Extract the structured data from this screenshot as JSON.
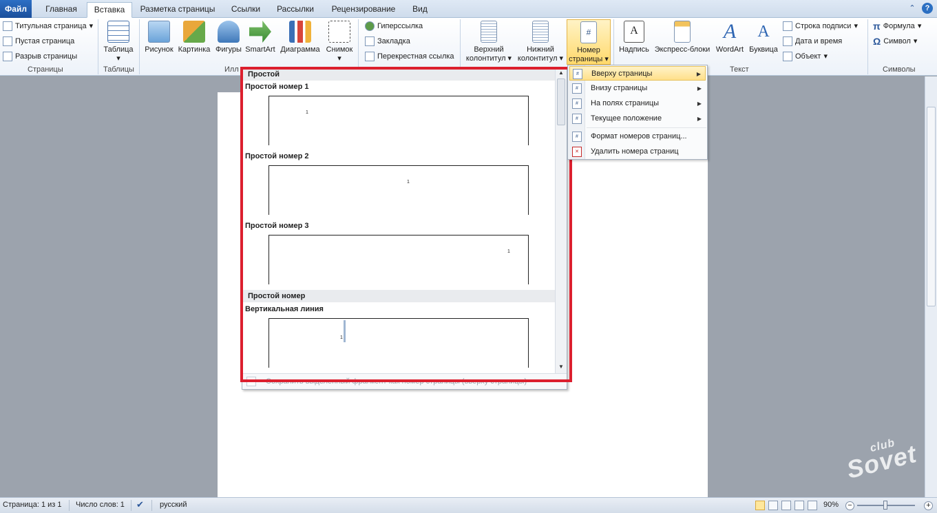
{
  "tabs": [
    {
      "label": "Файл",
      "state": "file"
    },
    {
      "label": "Главная"
    },
    {
      "label": "Вставка",
      "state": "active"
    },
    {
      "label": "Разметка страницы"
    },
    {
      "label": "Ссылки"
    },
    {
      "label": "Рассылки"
    },
    {
      "label": "Рецензирование"
    },
    {
      "label": "Вид"
    }
  ],
  "ribbon": {
    "pages": {
      "title_page": "Титульная страница",
      "blank_page": "Пустая страница",
      "page_break": "Разрыв страницы",
      "group": "Страницы"
    },
    "tables": {
      "table": "Таблица",
      "group": "Таблицы"
    },
    "illustrations": {
      "picture": "Рисунок",
      "clipart": "Картинка",
      "shapes": "Фигуры",
      "smartart": "SmartArt",
      "chart": "Диаграмма",
      "screenshot": "Снимок",
      "group": "Илл"
    },
    "links": {
      "hyperlink": "Гиперссылка",
      "bookmark": "Закладка",
      "crossref": "Перекрестная ссылка"
    },
    "header_footer": {
      "header1": "Верхний",
      "header2": "колонтитул",
      "footer1": "Нижний",
      "footer2": "колонтитул",
      "pagenum1": "Номер",
      "pagenum2": "страницы"
    },
    "text": {
      "textbox": "Надпись",
      "quickparts": "Экспресс-блоки",
      "wordart": "WordArt",
      "dropcap": "Буквица",
      "signature": "Строка подписи",
      "datetime": "Дата и время",
      "object": "Объект",
      "group": "Текст"
    },
    "symbols": {
      "formula": "Формула",
      "symbol": "Символ",
      "group": "Символы"
    }
  },
  "gallery": {
    "sections": [
      {
        "header": "Простой",
        "items": [
          {
            "title": "Простой номер 1",
            "num": "1",
            "align": "left"
          },
          {
            "title": "Простой номер 2",
            "num": "1",
            "align": "center"
          },
          {
            "title": "Простой номер 3",
            "num": "1",
            "align": "right"
          }
        ]
      },
      {
        "header": "Простой номер",
        "items": [
          {
            "title": "Вертикальная линия",
            "num": "1",
            "align": "vline"
          }
        ]
      }
    ],
    "footer": "Сохранить выделенный фрагмент как номер страницы (вверху страницы)"
  },
  "submenu": {
    "items": [
      {
        "label": "Вверху страницы",
        "has_arrow": true,
        "state": "hover"
      },
      {
        "label": "Внизу страницы",
        "has_arrow": true
      },
      {
        "label": "На полях страницы",
        "has_arrow": true
      },
      {
        "label": "Текущее положение",
        "has_arrow": true
      },
      {
        "label": "Формат номеров страниц...",
        "has_arrow": false
      },
      {
        "label": "Удалить номера страниц",
        "has_arrow": false
      }
    ]
  },
  "status": {
    "page": "Страница: 1 из 1",
    "words": "Число слов: 1",
    "language": "русский",
    "zoom": "90%",
    "zoom_fraction": 0.45
  },
  "watermark": {
    "line1": "club",
    "line2": "Sovet"
  },
  "colors": {
    "accent": "#2b579a",
    "highlight_frame": "#dc1f2e",
    "hover": "#ffe08a"
  }
}
